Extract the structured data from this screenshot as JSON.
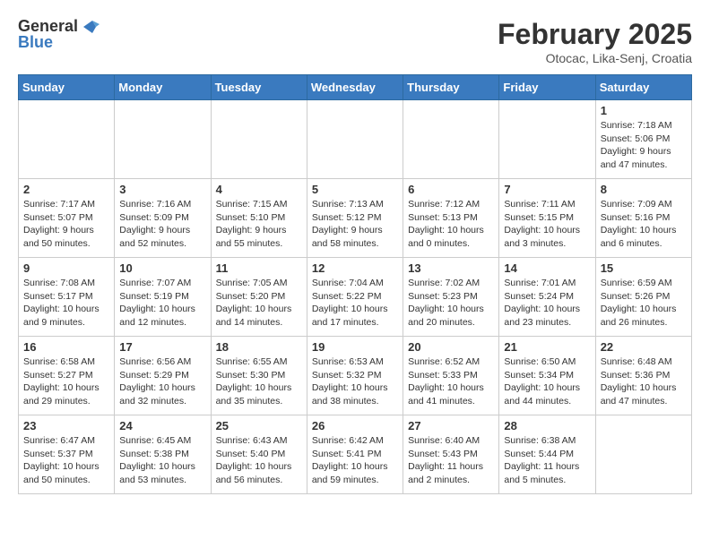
{
  "header": {
    "logo_general": "General",
    "logo_blue": "Blue",
    "month_title": "February 2025",
    "location": "Otocac, Lika-Senj, Croatia"
  },
  "weekdays": [
    "Sunday",
    "Monday",
    "Tuesday",
    "Wednesday",
    "Thursday",
    "Friday",
    "Saturday"
  ],
  "weeks": [
    [
      {
        "day": "",
        "info": ""
      },
      {
        "day": "",
        "info": ""
      },
      {
        "day": "",
        "info": ""
      },
      {
        "day": "",
        "info": ""
      },
      {
        "day": "",
        "info": ""
      },
      {
        "day": "",
        "info": ""
      },
      {
        "day": "1",
        "info": "Sunrise: 7:18 AM\nSunset: 5:06 PM\nDaylight: 9 hours and 47 minutes."
      }
    ],
    [
      {
        "day": "2",
        "info": "Sunrise: 7:17 AM\nSunset: 5:07 PM\nDaylight: 9 hours and 50 minutes."
      },
      {
        "day": "3",
        "info": "Sunrise: 7:16 AM\nSunset: 5:09 PM\nDaylight: 9 hours and 52 minutes."
      },
      {
        "day": "4",
        "info": "Sunrise: 7:15 AM\nSunset: 5:10 PM\nDaylight: 9 hours and 55 minutes."
      },
      {
        "day": "5",
        "info": "Sunrise: 7:13 AM\nSunset: 5:12 PM\nDaylight: 9 hours and 58 minutes."
      },
      {
        "day": "6",
        "info": "Sunrise: 7:12 AM\nSunset: 5:13 PM\nDaylight: 10 hours and 0 minutes."
      },
      {
        "day": "7",
        "info": "Sunrise: 7:11 AM\nSunset: 5:15 PM\nDaylight: 10 hours and 3 minutes."
      },
      {
        "day": "8",
        "info": "Sunrise: 7:09 AM\nSunset: 5:16 PM\nDaylight: 10 hours and 6 minutes."
      }
    ],
    [
      {
        "day": "9",
        "info": "Sunrise: 7:08 AM\nSunset: 5:17 PM\nDaylight: 10 hours and 9 minutes."
      },
      {
        "day": "10",
        "info": "Sunrise: 7:07 AM\nSunset: 5:19 PM\nDaylight: 10 hours and 12 minutes."
      },
      {
        "day": "11",
        "info": "Sunrise: 7:05 AM\nSunset: 5:20 PM\nDaylight: 10 hours and 14 minutes."
      },
      {
        "day": "12",
        "info": "Sunrise: 7:04 AM\nSunset: 5:22 PM\nDaylight: 10 hours and 17 minutes."
      },
      {
        "day": "13",
        "info": "Sunrise: 7:02 AM\nSunset: 5:23 PM\nDaylight: 10 hours and 20 minutes."
      },
      {
        "day": "14",
        "info": "Sunrise: 7:01 AM\nSunset: 5:24 PM\nDaylight: 10 hours and 23 minutes."
      },
      {
        "day": "15",
        "info": "Sunrise: 6:59 AM\nSunset: 5:26 PM\nDaylight: 10 hours and 26 minutes."
      }
    ],
    [
      {
        "day": "16",
        "info": "Sunrise: 6:58 AM\nSunset: 5:27 PM\nDaylight: 10 hours and 29 minutes."
      },
      {
        "day": "17",
        "info": "Sunrise: 6:56 AM\nSunset: 5:29 PM\nDaylight: 10 hours and 32 minutes."
      },
      {
        "day": "18",
        "info": "Sunrise: 6:55 AM\nSunset: 5:30 PM\nDaylight: 10 hours and 35 minutes."
      },
      {
        "day": "19",
        "info": "Sunrise: 6:53 AM\nSunset: 5:32 PM\nDaylight: 10 hours and 38 minutes."
      },
      {
        "day": "20",
        "info": "Sunrise: 6:52 AM\nSunset: 5:33 PM\nDaylight: 10 hours and 41 minutes."
      },
      {
        "day": "21",
        "info": "Sunrise: 6:50 AM\nSunset: 5:34 PM\nDaylight: 10 hours and 44 minutes."
      },
      {
        "day": "22",
        "info": "Sunrise: 6:48 AM\nSunset: 5:36 PM\nDaylight: 10 hours and 47 minutes."
      }
    ],
    [
      {
        "day": "23",
        "info": "Sunrise: 6:47 AM\nSunset: 5:37 PM\nDaylight: 10 hours and 50 minutes."
      },
      {
        "day": "24",
        "info": "Sunrise: 6:45 AM\nSunset: 5:38 PM\nDaylight: 10 hours and 53 minutes."
      },
      {
        "day": "25",
        "info": "Sunrise: 6:43 AM\nSunset: 5:40 PM\nDaylight: 10 hours and 56 minutes."
      },
      {
        "day": "26",
        "info": "Sunrise: 6:42 AM\nSunset: 5:41 PM\nDaylight: 10 hours and 59 minutes."
      },
      {
        "day": "27",
        "info": "Sunrise: 6:40 AM\nSunset: 5:43 PM\nDaylight: 11 hours and 2 minutes."
      },
      {
        "day": "28",
        "info": "Sunrise: 6:38 AM\nSunset: 5:44 PM\nDaylight: 11 hours and 5 minutes."
      },
      {
        "day": "",
        "info": ""
      }
    ]
  ]
}
